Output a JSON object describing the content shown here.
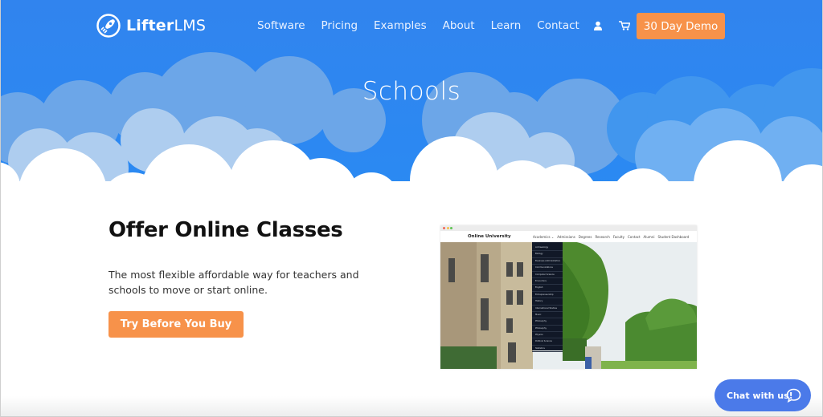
{
  "nav": {
    "logo": {
      "bold": "Lifter",
      "light": "LMS",
      "icon": "rocket-icon"
    },
    "menu": [
      "Software",
      "Pricing",
      "Examples",
      "About",
      "Learn",
      "Contact"
    ],
    "icons": [
      "user-icon",
      "cart-icon"
    ],
    "demo_button": "30 Day Demo"
  },
  "hero": {
    "title": "Schools"
  },
  "main": {
    "headline": "Offer Online Classes",
    "description": "The most flexible affordable way for teachers and schools to move or start online.",
    "cta_button": "Try Before You Buy"
  },
  "mockup": {
    "brand": "Online University",
    "links": [
      "Academics ⌄",
      "Admissions",
      "Degrees",
      "Research",
      "Faculty",
      "Contact",
      "Alumni",
      "Student Dashboard"
    ],
    "dropdown": [
      "Archaeology",
      "Biology",
      "Business Administration",
      "Communications",
      "Computer Science",
      "Economics",
      "English",
      "Entrepreneurship",
      "History",
      "International Studies",
      "Music",
      "Philosophy",
      "Philosophy",
      "Physics",
      "Political Science",
      "Statistics"
    ]
  },
  "chat": {
    "label": "Chat with us!",
    "icon": "chat-bubble-icon"
  },
  "colors": {
    "primary": "#2f86f0",
    "accent": "#f7924a",
    "chat": "#4b7ae9"
  }
}
